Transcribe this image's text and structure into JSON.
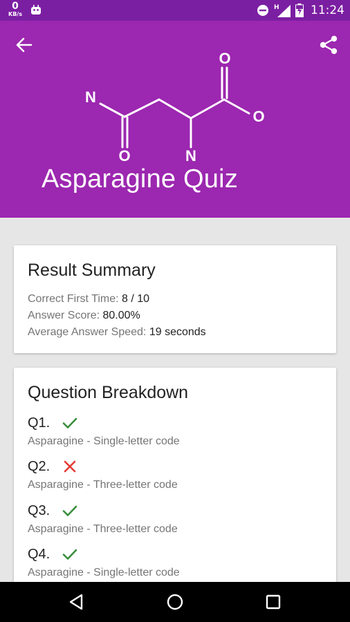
{
  "status_bar": {
    "net_speed": "0",
    "net_unit": "KB/s",
    "signal_type": "H",
    "time": "11:24",
    "icons": [
      "android-debug-icon",
      "do-not-disturb-icon",
      "signal-icon",
      "battery-charging-icon"
    ]
  },
  "header": {
    "title": "Asparagine Quiz",
    "back_icon": "arrow-back-icon",
    "share_icon": "share-icon",
    "background_color": "#9c27b0",
    "molecule_atoms": {
      "n_left": "N",
      "o_top": "O",
      "o_right": "O",
      "o_bottom": "O",
      "n_bottom": "N"
    }
  },
  "summary": {
    "title": "Result Summary",
    "correct_first_time_label": "Correct First Time:",
    "correct_first_time_value": "8 / 10",
    "answer_score_label": "Answer Score:",
    "answer_score_value": "80.00%",
    "avg_speed_label": "Average Answer Speed:",
    "avg_speed_value": "19 seconds"
  },
  "breakdown": {
    "title": "Question Breakdown",
    "questions": [
      {
        "number": "Q1.",
        "correct": true,
        "description": "Asparagine - Single-letter code"
      },
      {
        "number": "Q2.",
        "correct": false,
        "description": "Asparagine - Three-letter code"
      },
      {
        "number": "Q3.",
        "correct": true,
        "description": "Asparagine - Three-letter code"
      },
      {
        "number": "Q4.",
        "correct": true,
        "description": "Asparagine - Single-letter code"
      }
    ],
    "correct_color": "#388e3c",
    "incorrect_color": "#e53935"
  },
  "nav_bar": {
    "icons": [
      "back-triangle-icon",
      "home-circle-icon",
      "recents-square-icon"
    ]
  }
}
